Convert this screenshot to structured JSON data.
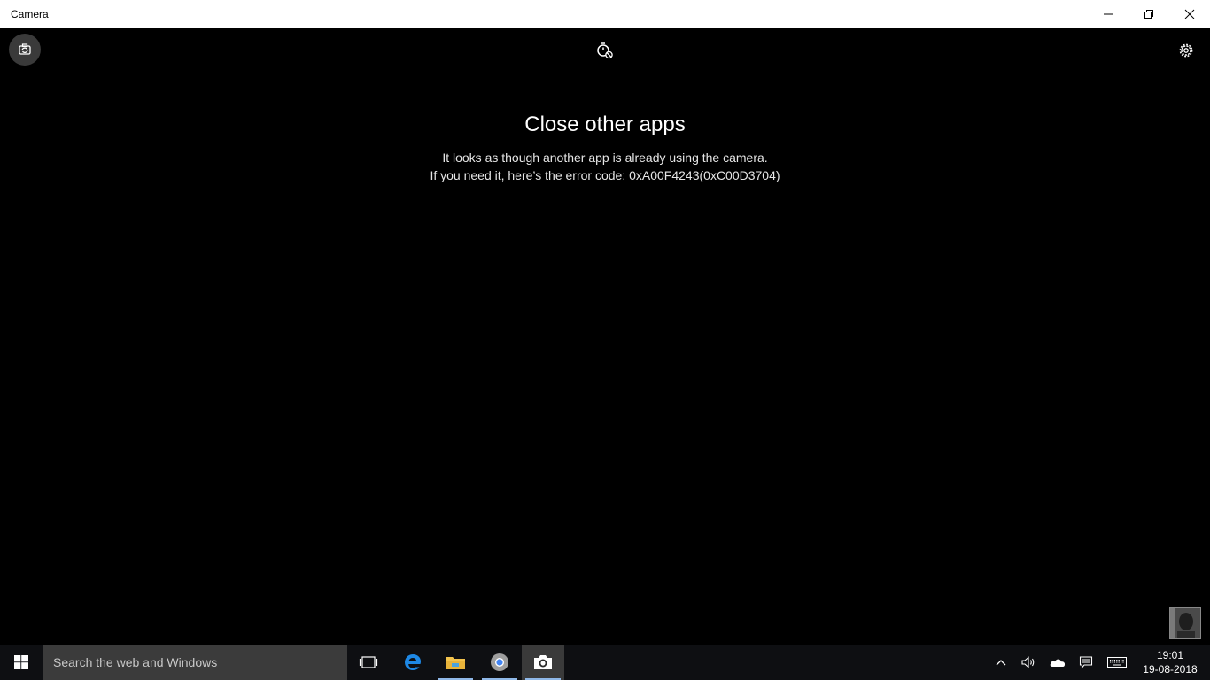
{
  "window": {
    "title": "Camera",
    "controls": [
      "minimize",
      "restore",
      "close"
    ]
  },
  "toolbar": {
    "switch_camera_icon": "switch-camera-icon",
    "timer_icon": "timer-off-icon",
    "settings_icon": "gear-icon"
  },
  "message": {
    "heading": "Close other apps",
    "line1": "It looks as though another app is already using the camera.",
    "line2": "If you need it, here’s the error code: 0xA00F4243(0xC00D3704)"
  },
  "taskbar": {
    "search_placeholder": "Search the web and Windows",
    "pinned": [
      "task-view",
      "edge",
      "file-explorer",
      "chrome",
      "camera"
    ],
    "clock_time": "19:01",
    "clock_date": "19-08-2018"
  },
  "colors": {
    "app_bg": "#000000",
    "titlebar_bg": "#ffffff",
    "taskbar_bg": "#0e0f12",
    "searchbox_bg": "#3b3b3b",
    "edge_blue": "#1e88e5"
  }
}
